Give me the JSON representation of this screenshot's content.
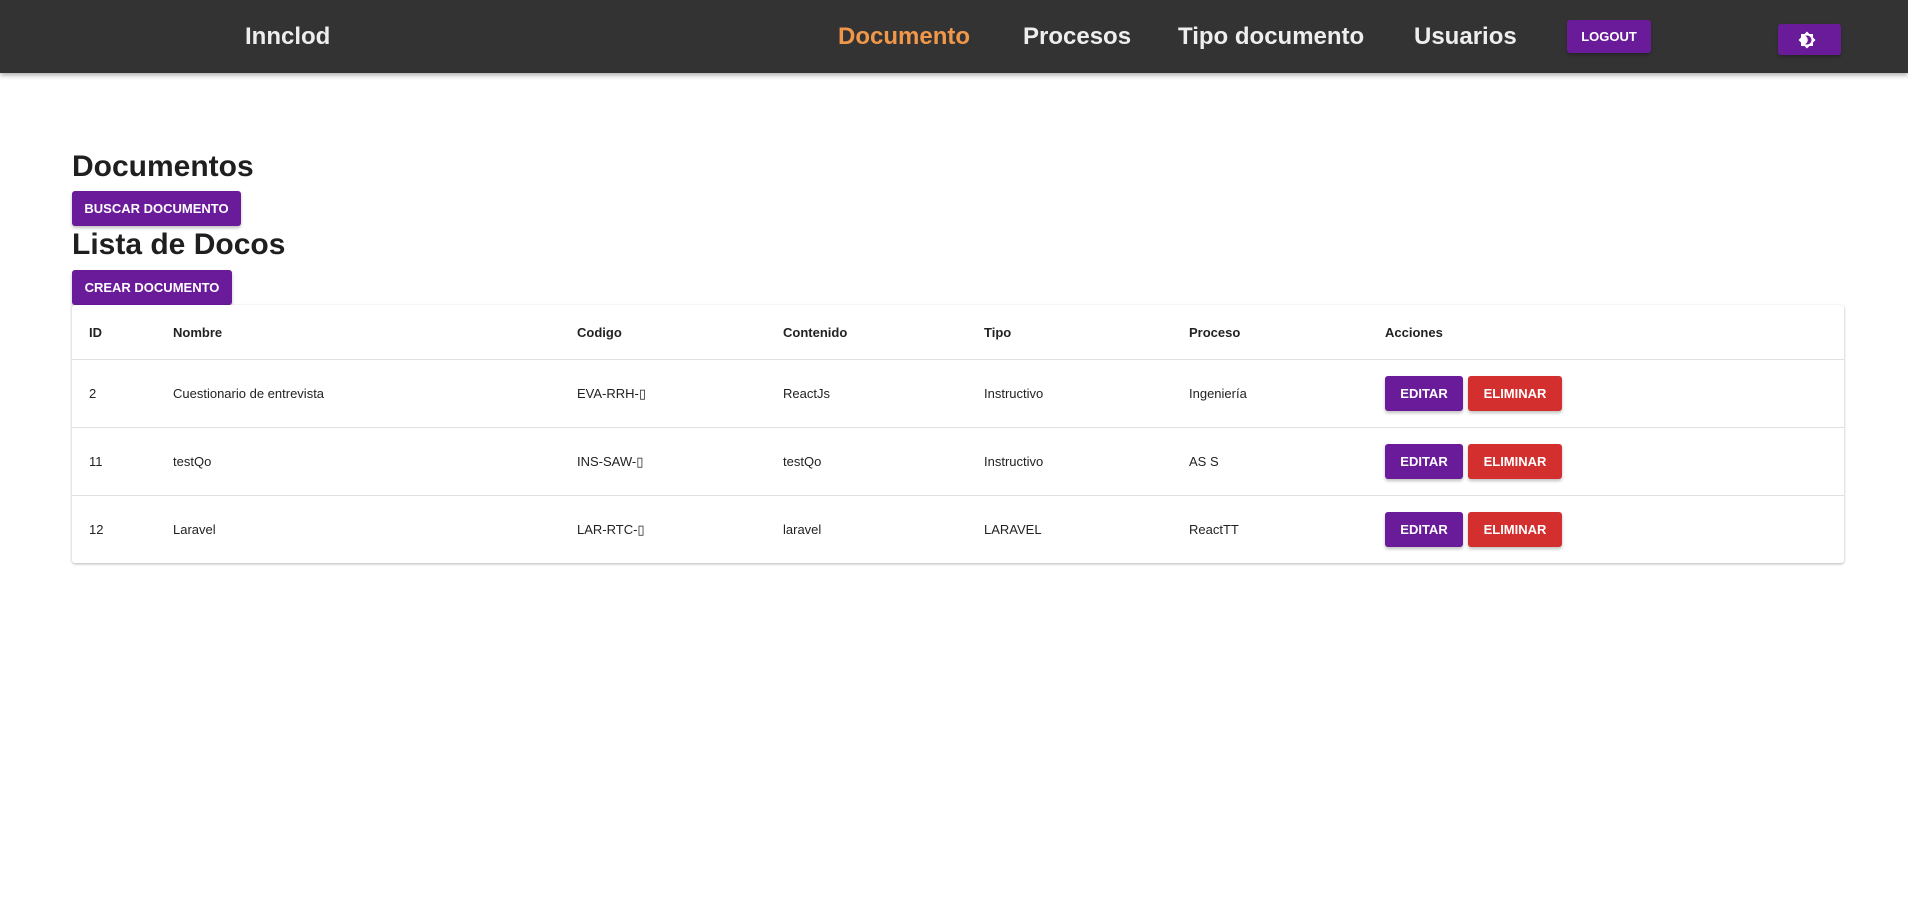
{
  "navbar": {
    "brand": "Innclod",
    "links": [
      {
        "label": "Documento",
        "active": true
      },
      {
        "label": "Procesos",
        "active": false
      },
      {
        "label": "Tipo documento",
        "active": false
      },
      {
        "label": "Usuarios",
        "active": false
      }
    ],
    "logout_label": "LOGOUT",
    "theme_toggle_icon": "brightness-icon"
  },
  "colors": {
    "navbar_bg": "#333333",
    "active_link": "#f0974a",
    "primary": "#6a1b9a",
    "danger": "#d32f2f"
  },
  "main": {
    "title": "Documentos",
    "search_button": "BUSCAR DOCUMENTO",
    "list_title": "Lista de Docos",
    "create_button": "CREAR DOCUMENTO"
  },
  "table": {
    "columns": [
      "ID",
      "Nombre",
      "Codigo",
      "Contenido",
      "Tipo",
      "Proceso",
      "Acciones"
    ],
    "rows": [
      {
        "id": "2",
        "nombre": "Cuestionario de entrevista",
        "codigo": "EVA-RRH-▯",
        "contenido": "ReactJs",
        "tipo": "Instructivo",
        "proceso": "Ingeniería"
      },
      {
        "id": "11",
        "nombre": "testQo",
        "codigo": "INS-SAW-▯",
        "contenido": "testQo",
        "tipo": "Instructivo",
        "proceso": "AS S"
      },
      {
        "id": "12",
        "nombre": "Laravel",
        "codigo": "LAR-RTC-▯",
        "contenido": "laravel",
        "tipo": "LARAVEL",
        "proceso": "ReactTT"
      }
    ],
    "edit_label": "EDITAR",
    "delete_label": "ELIMINAR"
  }
}
